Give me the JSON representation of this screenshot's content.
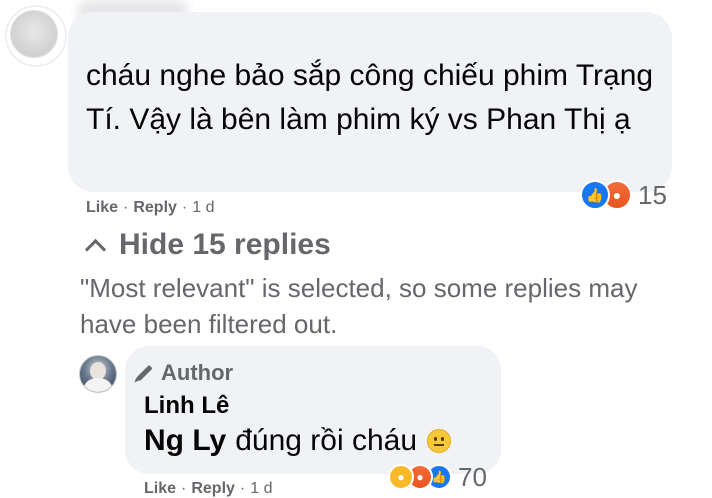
{
  "comment": {
    "text": "cháu nghe bảo sắp công chiếu phim Trạng Tí. Vậy là bên làm phim ký vs Phan Thị ạ",
    "actions": {
      "like": "Like",
      "reply": "Reply",
      "time": "1 d",
      "separator": "·"
    },
    "reaction_count": "15",
    "reaction_icons": [
      "like-icon",
      "angry-icon"
    ]
  },
  "replies_toggle": {
    "label": "Hide 15 replies"
  },
  "filter_note": "\"Most relevant\" is selected, so some replies may have been filtered out.",
  "reply": {
    "badge": "Author",
    "author": "Linh Lê",
    "mention": "Ng Ly",
    "text": "đúng rồi cháu",
    "emoji": "neutral-face-emoji",
    "reaction_count": "70",
    "reaction_icons": [
      "sad-icon",
      "angry-icon",
      "like-icon"
    ],
    "actions": {
      "like": "Like",
      "reply": "Reply",
      "time": "1 d",
      "separator": "·"
    }
  },
  "colors": {
    "bubble": "#f0f2f5",
    "secondary_text": "#65676b",
    "like_blue": "#1877f2"
  }
}
